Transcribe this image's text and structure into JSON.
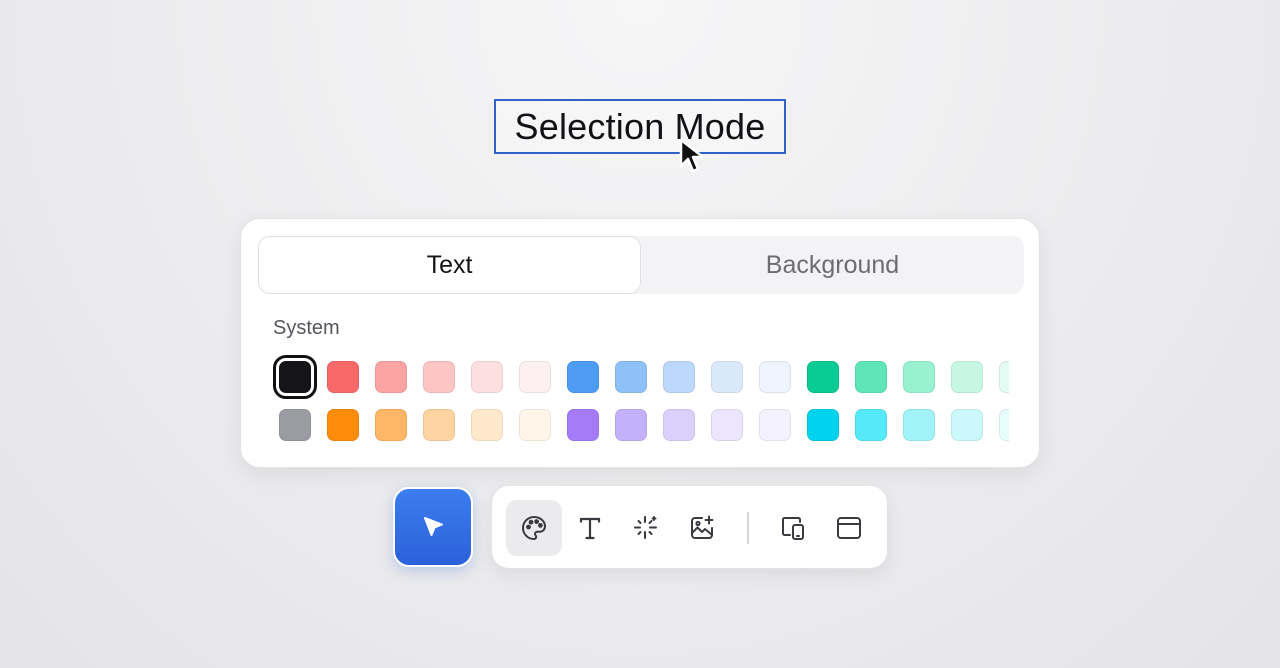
{
  "title": "Selection Mode",
  "tabs": {
    "text": "Text",
    "background": "Background",
    "active": "Text"
  },
  "palette": {
    "label": "System",
    "selected_color": "#151518",
    "rows": [
      [
        "#151518",
        "#f86a6a",
        "#fca3a3",
        "#fec5c5",
        "#fddfdf",
        "#fdf0f0",
        "#4f9cf5",
        "#8fc1f9",
        "#bcd8fb",
        "#dae8fc",
        "#edf4fe",
        "#0acb93",
        "#5ee5b8",
        "#98f1d1",
        "#c6f7e4",
        "#e3fbf2"
      ],
      [
        "#9b9ba3",
        "#ff8b0a",
        "#ffb666",
        "#ffd4a1",
        "#ffe8cc",
        "#fff5e8",
        "#a57bf9",
        "#c5b1fb",
        "#dbd0fc",
        "#ebe6fd",
        "#f4f2fe",
        "#00d3ee",
        "#56eaf8",
        "#9ff3f9",
        "#cbf8fb",
        "#e6fcfd"
      ]
    ]
  },
  "toolbar": {
    "select_tool": {
      "icon": "pointer-arrow-icon"
    },
    "tools": [
      {
        "icon": "palette-icon",
        "active": true
      },
      {
        "icon": "text-icon",
        "active": false
      },
      {
        "icon": "sparkles-icon",
        "active": false
      },
      {
        "icon": "image-sparkle-icon",
        "active": false
      },
      {
        "icon": "devices-icon",
        "active": false
      },
      {
        "icon": "window-icon",
        "active": false
      }
    ]
  },
  "colors": {
    "selection_border": "#2f63c9",
    "select_button": "#3170e6",
    "panel_bg": "#ffffff"
  }
}
